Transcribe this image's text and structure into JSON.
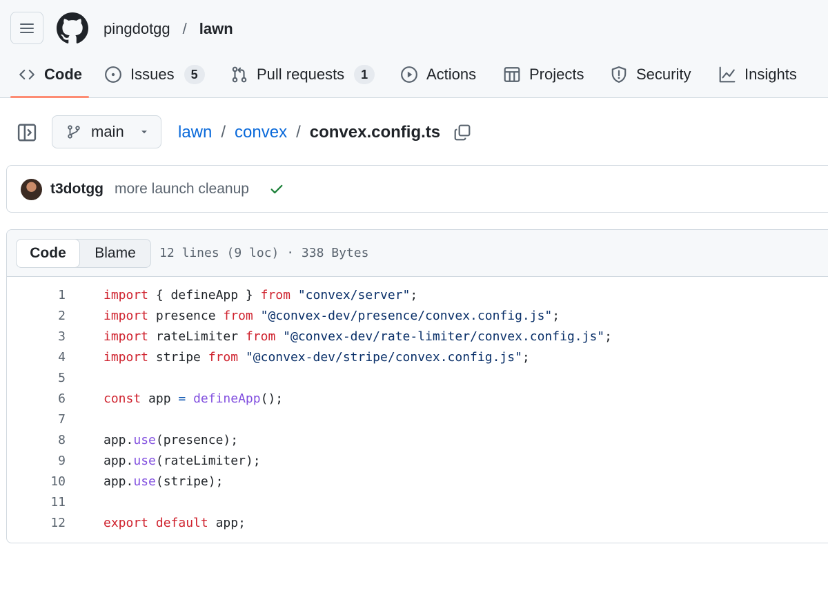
{
  "repo_header": {
    "owner": "pingdotgg",
    "separator": "/",
    "repo": "lawn"
  },
  "tabs": [
    {
      "label": "Code",
      "icon": "code-icon",
      "active": true
    },
    {
      "label": "Issues",
      "icon": "issue-opened-icon",
      "count": "5"
    },
    {
      "label": "Pull requests",
      "icon": "git-pull-request-icon",
      "count": "1"
    },
    {
      "label": "Actions",
      "icon": "play-icon"
    },
    {
      "label": "Projects",
      "icon": "table-icon"
    },
    {
      "label": "Security",
      "icon": "shield-icon"
    },
    {
      "label": "Insights",
      "icon": "graph-icon"
    }
  ],
  "branch": {
    "name": "main",
    "icon": "git-branch-icon"
  },
  "path": {
    "segments": [
      "lawn",
      "convex"
    ],
    "separator": "/",
    "file": "convex.config.ts"
  },
  "commit": {
    "author": "t3dotgg",
    "message": "more launch cleanup",
    "status": "success",
    "status_color": "#1a7f37"
  },
  "file_view": {
    "modes": [
      "Code",
      "Blame"
    ],
    "active_mode": "Code",
    "meta": "12 lines (9 loc) · 338 Bytes"
  },
  "code_lines": [
    {
      "n": "1",
      "text": "import { defineApp } from \"convex/server\";"
    },
    {
      "n": "2",
      "text": "import presence from \"@convex-dev/presence/convex.config.js\";"
    },
    {
      "n": "3",
      "text": "import rateLimiter from \"@convex-dev/rate-limiter/convex.config.js\";"
    },
    {
      "n": "4",
      "text": "import stripe from \"@convex-dev/stripe/convex.config.js\";"
    },
    {
      "n": "5",
      "text": ""
    },
    {
      "n": "6",
      "text": "const app = defineApp();"
    },
    {
      "n": "7",
      "text": ""
    },
    {
      "n": "8",
      "text": "app.use(presence);"
    },
    {
      "n": "9",
      "text": "app.use(rateLimiter);"
    },
    {
      "n": "10",
      "text": "app.use(stripe);"
    },
    {
      "n": "11",
      "text": ""
    },
    {
      "n": "12",
      "text": "export default app;"
    }
  ],
  "colors": {
    "link": "#0969da",
    "tab_underline": "#fd8c73",
    "keyword": "#cf222e",
    "string": "#0a3069",
    "function": "#8250df"
  }
}
